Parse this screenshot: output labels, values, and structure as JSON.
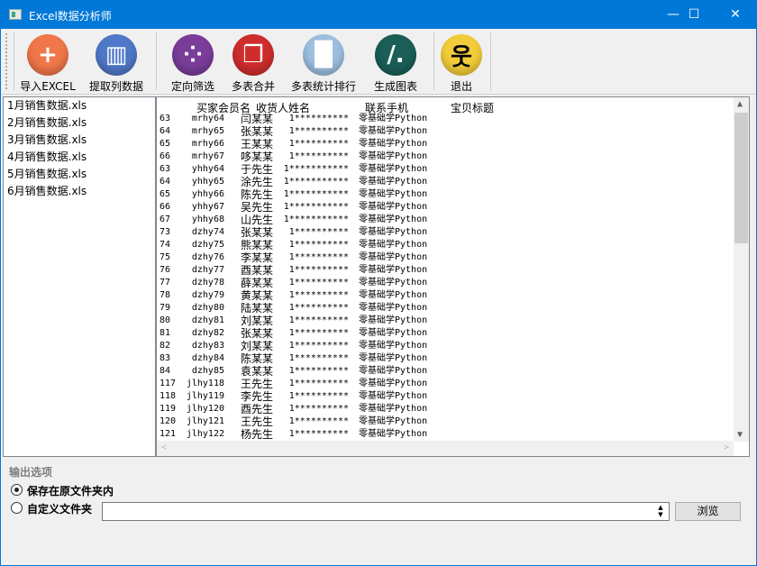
{
  "window": {
    "title": "Excel数据分析师",
    "min": "—",
    "max": "☐",
    "close": "✕"
  },
  "toolbar": [
    {
      "id": "import",
      "label": "导入EXCEL",
      "icon": "plus-icon",
      "color": "#f0774a"
    },
    {
      "id": "extract",
      "label": "提取列数据",
      "icon": "column-extract-icon",
      "color": "#4f78c8"
    },
    {
      "id": "filter",
      "label": "定向筛选",
      "icon": "dots-filter-icon",
      "color": "#7a3d9a"
    },
    {
      "id": "merge",
      "label": "多表合并",
      "icon": "merge-docs-icon",
      "color": "#cf2d2d"
    },
    {
      "id": "rank",
      "label": "多表统计排行",
      "icon": "bar-chart-icon",
      "color": "#9dbfe0"
    },
    {
      "id": "chart",
      "label": "生成图表",
      "icon": "chart-slash-icon",
      "color": "#1a5e57"
    },
    {
      "id": "exit",
      "label": "退出",
      "icon": "running-man-icon",
      "color": "#f2cc3a"
    }
  ],
  "files": [
    "1月销售数据.xls",
    "2月销售数据.xls",
    "3月销售数据.xls",
    "4月销售数据.xls",
    "5月销售数据.xls",
    "6月销售数据.xls"
  ],
  "table": {
    "headers": [
      "买家会员名",
      "收货人姓名",
      "联系手机",
      "宝贝标题"
    ],
    "rows": [
      [
        "63",
        "mrhy64",
        "闫某某",
        "1**********",
        "零基础学Python"
      ],
      [
        "64",
        "mrhy65",
        "张某某",
        "1**********",
        "零基础学Python"
      ],
      [
        "65",
        "mrhy66",
        "王某某",
        "1**********",
        "零基础学Python"
      ],
      [
        "66",
        "mrhy67",
        "哆某某",
        "1**********",
        "零基础学Python"
      ],
      [
        "63",
        "yhhy64",
        "于先生",
        "1***********",
        "零基础学Python"
      ],
      [
        "64",
        "yhhy65",
        "涂先生",
        "1***********",
        "零基础学Python"
      ],
      [
        "65",
        "yhhy66",
        "陈先生",
        "1***********",
        "零基础学Python"
      ],
      [
        "66",
        "yhhy67",
        "吴先生",
        "1***********",
        "零基础学Python"
      ],
      [
        "67",
        "yhhy68",
        "山先生",
        "1***********",
        "零基础学Python"
      ],
      [
        "73",
        "dzhy74",
        "张某某",
        "1**********",
        "零基础学Python"
      ],
      [
        "74",
        "dzhy75",
        "熊某某",
        "1**********",
        "零基础学Python"
      ],
      [
        "75",
        "dzhy76",
        "李某某",
        "1**********",
        "零基础学Python"
      ],
      [
        "76",
        "dzhy77",
        "酉某某",
        "1**********",
        "零基础学Python"
      ],
      [
        "77",
        "dzhy78",
        "薛某某",
        "1**********",
        "零基础学Python"
      ],
      [
        "78",
        "dzhy79",
        "黄某某",
        "1**********",
        "零基础学Python"
      ],
      [
        "79",
        "dzhy80",
        "陆某某",
        "1**********",
        "零基础学Python"
      ],
      [
        "80",
        "dzhy81",
        "刘某某",
        "1**********",
        "零基础学Python"
      ],
      [
        "81",
        "dzhy82",
        "张某某",
        "1**********",
        "零基础学Python"
      ],
      [
        "82",
        "dzhy83",
        "刘某某",
        "1**********",
        "零基础学Python"
      ],
      [
        "83",
        "dzhy84",
        "陈某某",
        "1**********",
        "零基础学Python"
      ],
      [
        "84",
        "dzhy85",
        "袁某某",
        "1**********",
        "零基础学Python"
      ],
      [
        "117",
        "jlhy118",
        "王先生",
        "1**********",
        "零基础学Python"
      ],
      [
        "118",
        "jlhy119",
        "李先生",
        "1**********",
        "零基础学Python"
      ],
      [
        "119",
        "jlhy120",
        "酉先生",
        "1**********",
        "零基础学Python"
      ],
      [
        "120",
        "jlhy121",
        "王先生",
        "1**********",
        "零基础学Python"
      ],
      [
        "121",
        "jlhy122",
        "杨先生",
        "1**********",
        "零基础学Python"
      ]
    ]
  },
  "output": {
    "title": "输出选项",
    "opt1": "保存在原文件夹内",
    "opt2": "自定义文件夹",
    "path_value": "",
    "browse": "浏览",
    "selected": "opt1"
  }
}
